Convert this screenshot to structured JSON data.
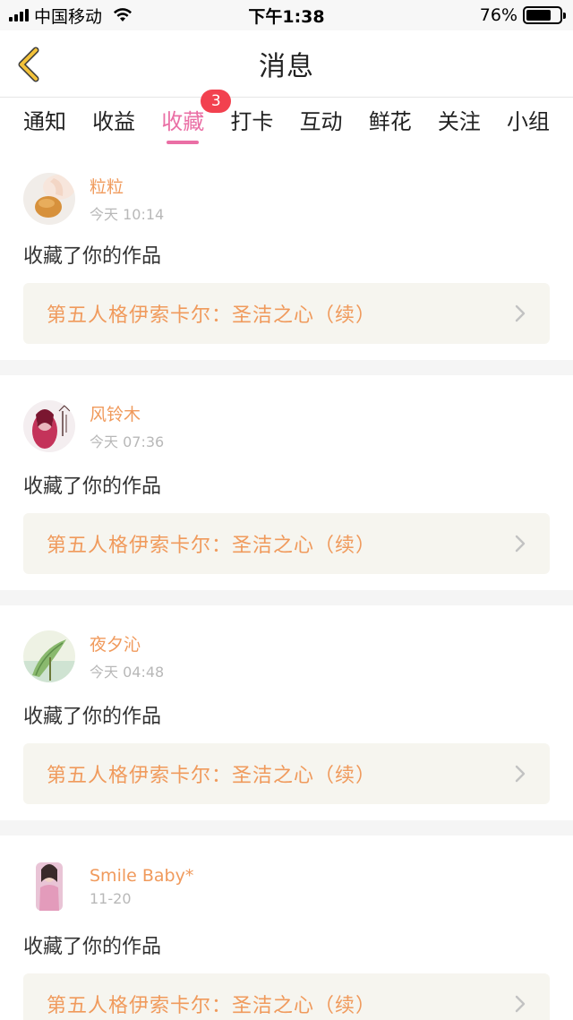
{
  "status_bar": {
    "carrier": "中国移动",
    "time": "下午1:38",
    "battery": "76%",
    "battery_level": 0.76
  },
  "nav": {
    "title": "消息",
    "back_icon": "chevron-left-icon"
  },
  "tabs": [
    {
      "label": "通知",
      "active": false
    },
    {
      "label": "收益",
      "active": false
    },
    {
      "label": "收藏",
      "active": true,
      "badge": "3"
    },
    {
      "label": "打卡",
      "active": false
    },
    {
      "label": "互动",
      "active": false
    },
    {
      "label": "鲜花",
      "active": false
    },
    {
      "label": "关注",
      "active": false
    },
    {
      "label": "小组",
      "active": false
    }
  ],
  "notifications": [
    {
      "username": "粒粒",
      "time": "今天 10:14",
      "action": "收藏了你的作品",
      "work_title": "第五人格伊索卡尔：圣洁之心（续）"
    },
    {
      "username": "风铃木",
      "time": "今天 07:36",
      "action": "收藏了你的作品",
      "work_title": "第五人格伊索卡尔：圣洁之心（续）"
    },
    {
      "username": "夜夕沁",
      "time": "今天 04:48",
      "action": "收藏了你的作品",
      "work_title": "第五人格伊索卡尔：圣洁之心（续）"
    },
    {
      "username": "Smile Baby*",
      "time": "11-20",
      "action": "收藏了你的作品",
      "work_title": "第五人格伊索卡尔：圣洁之心（续）"
    }
  ],
  "colors": {
    "accent_pink": "#ea6fa5",
    "badge_red": "#f2414f",
    "username_orange": "#f09a5c",
    "back_arrow_yellow": "#f3c23a"
  }
}
